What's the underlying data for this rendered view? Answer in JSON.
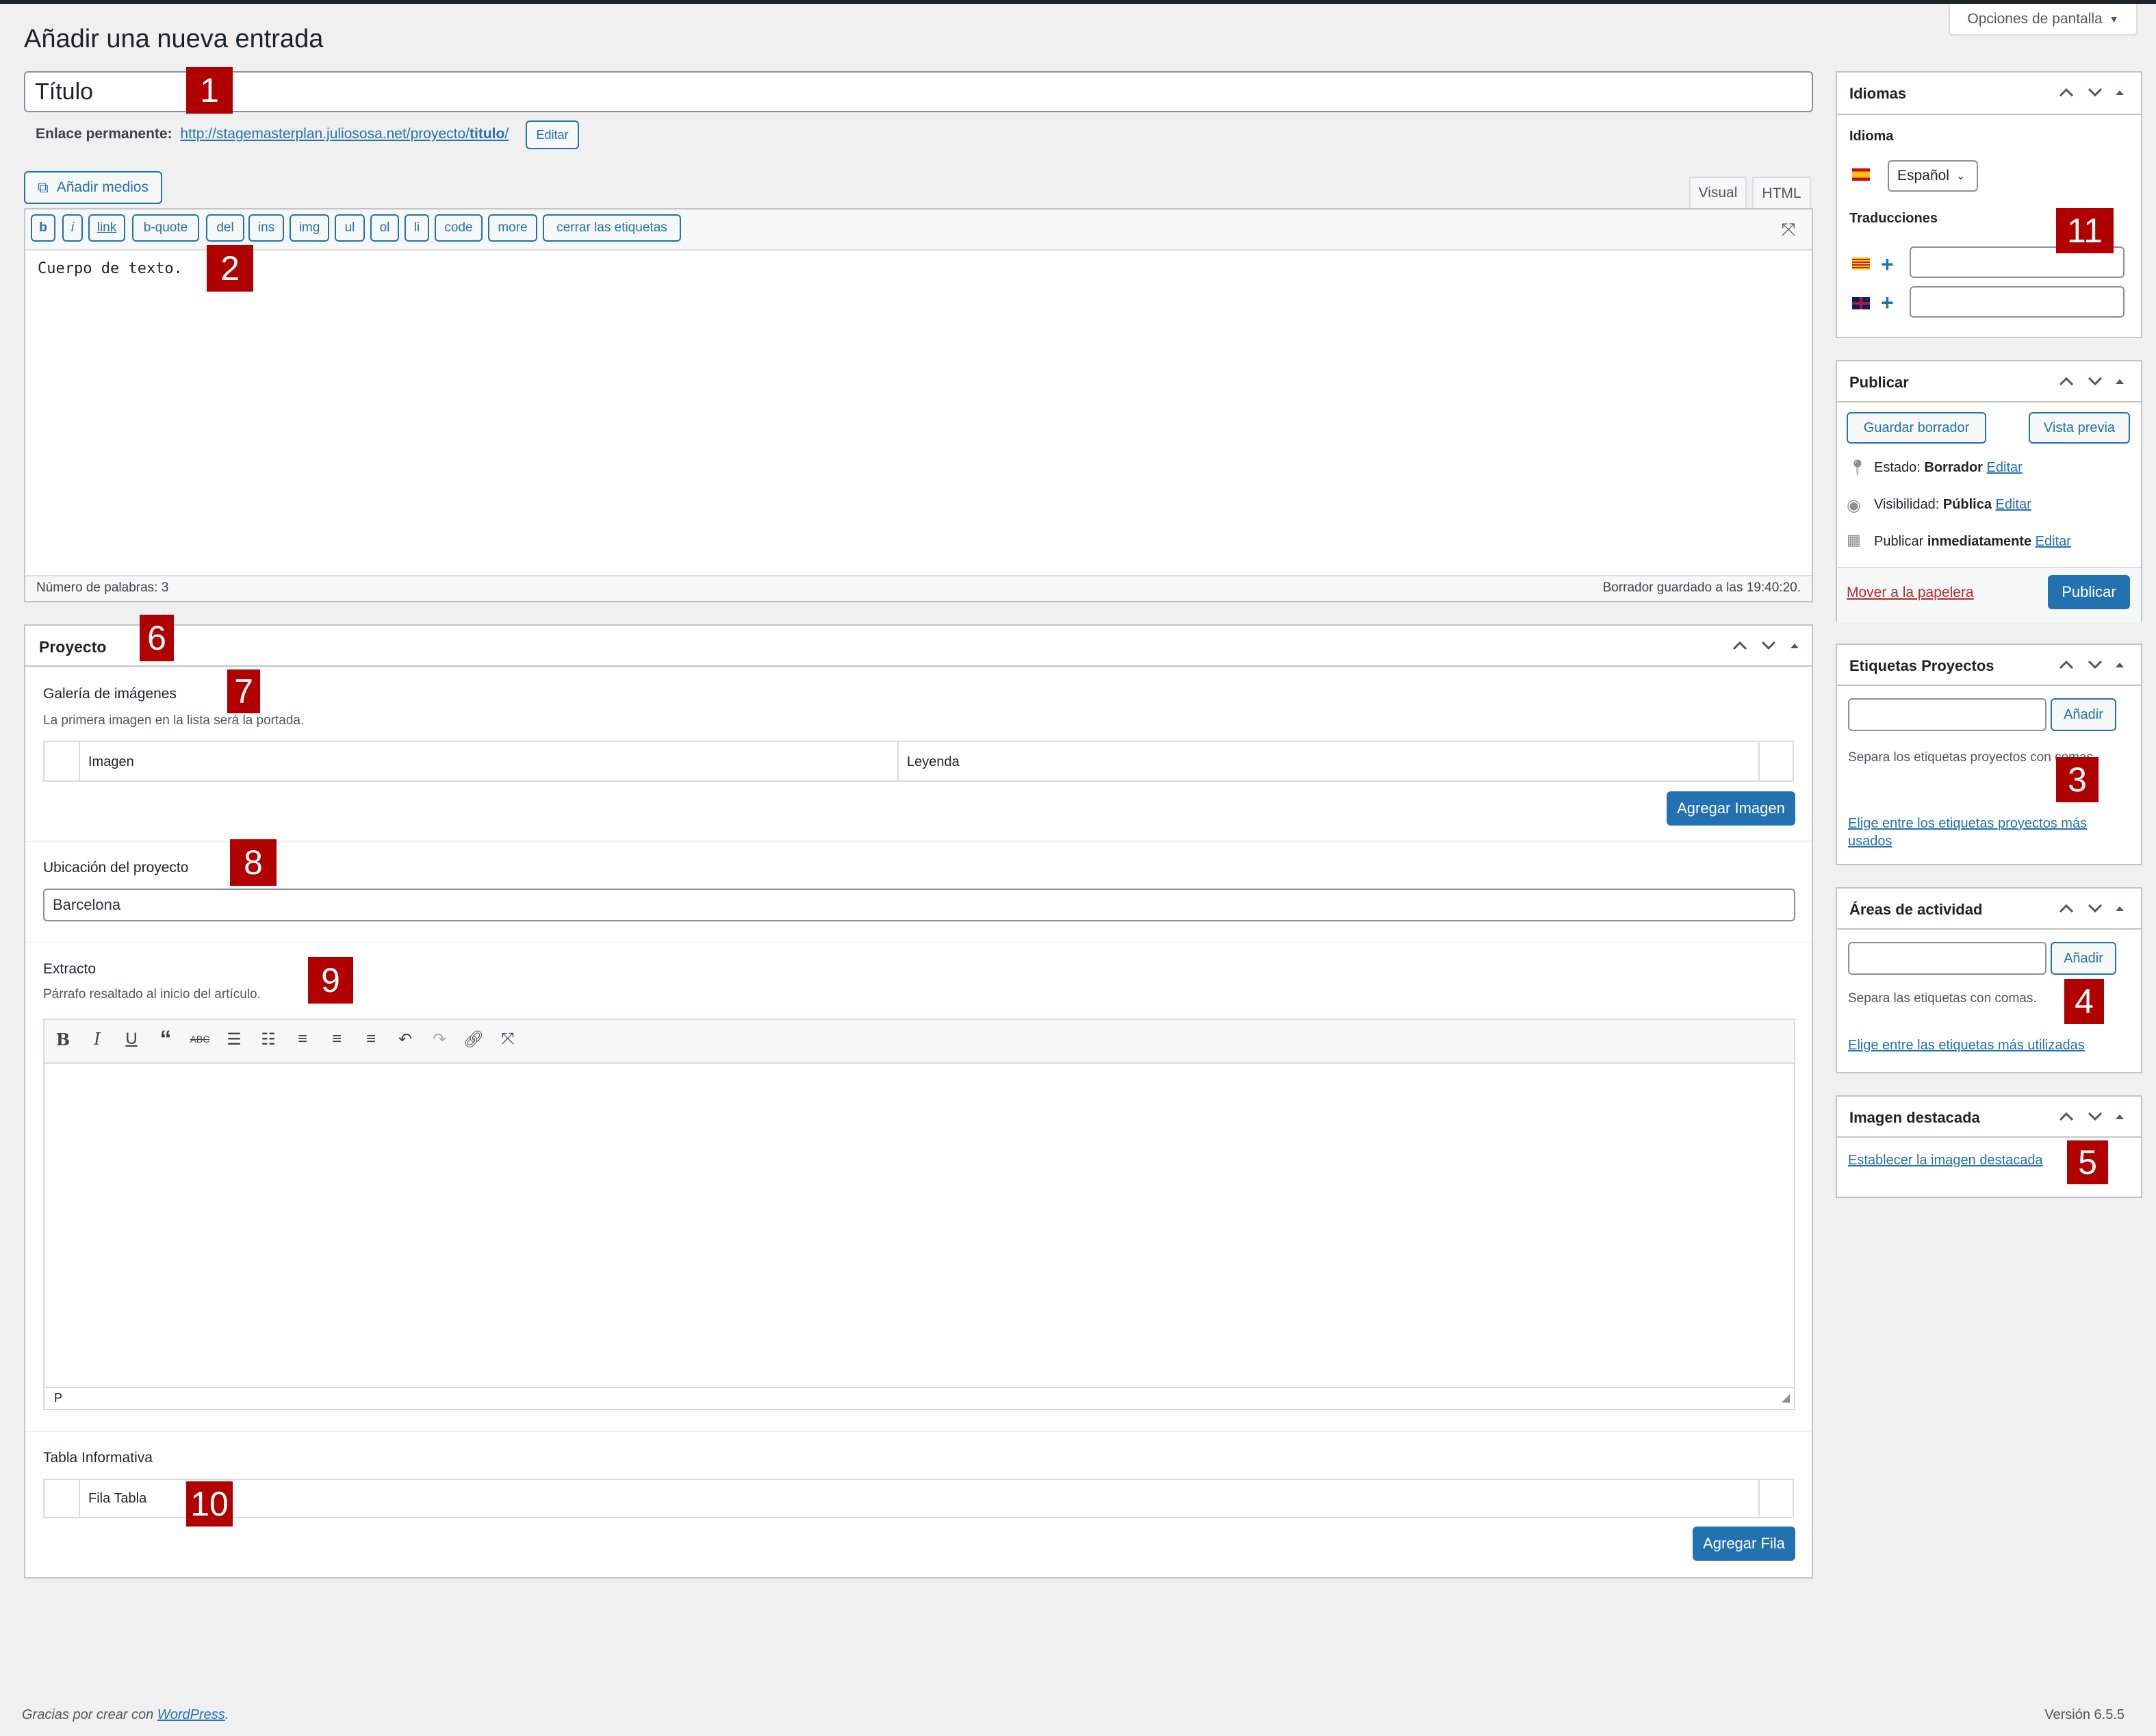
{
  "header": {
    "page_title": "Añadir una nueva entrada",
    "screen_options": "Opciones de pantalla"
  },
  "title_field": {
    "value": "Título"
  },
  "permalink": {
    "label": "Enlace permanente:",
    "url_base": "http://stagemasterplan.juliososa.net/proyecto/",
    "url_slug": "titulo",
    "url_end": "/",
    "edit_button": "Editar"
  },
  "editor": {
    "add_media": "Añadir medios",
    "tab_visual": "Visual",
    "tab_html": "HTML",
    "quicktags": [
      "b",
      "i",
      "link",
      "b-quote",
      "del",
      "ins",
      "img",
      "ul",
      "ol",
      "li",
      "code",
      "more",
      "cerrar las etiquetas"
    ],
    "content": "Cuerpo de texto.",
    "word_count": "Número de palabras: 3",
    "draft_saved": "Borrador guardado a las 19:40:20."
  },
  "proyecto": {
    "title": "Proyecto",
    "gallery": {
      "label": "Galería de imágenes",
      "description": "La primera imagen en la lista será la portada.",
      "columns": [
        "Imagen",
        "Leyenda"
      ],
      "add_button": "Agregar Imagen"
    },
    "location": {
      "label": "Ubicación del proyecto",
      "value": "Barcelona"
    },
    "excerpt": {
      "label": "Extracto",
      "description": "Párrafo resaltado al inicio del artículo.",
      "path": "P",
      "toolbar_icons": [
        "bold-icon",
        "italic-icon",
        "underline-icon",
        "blockquote-icon",
        "strikethrough-icon",
        "bullet-list-icon",
        "numbered-list-icon",
        "align-left-icon",
        "align-center-icon",
        "align-right-icon",
        "undo-icon",
        "redo-icon",
        "link-icon",
        "fullscreen-icon"
      ]
    },
    "info_table": {
      "label": "Tabla Informativa",
      "row_label": "Fila Tabla",
      "add_button": "Agregar Fila"
    }
  },
  "idiomas": {
    "title": "Idiomas",
    "language_label": "Idioma",
    "language_value": "Español",
    "translations_label": "Traducciones"
  },
  "publicar": {
    "title": "Publicar",
    "save_draft": "Guardar borrador",
    "preview": "Vista previa",
    "status_label": "Estado:",
    "status_value": "Borrador",
    "visibility_label": "Visibilidad:",
    "visibility_value": "Pública",
    "publish_label": "Publicar",
    "publish_value": "inmediatamente",
    "edit": "Editar",
    "trash": "Mover a la papelera",
    "publish_button": "Publicar"
  },
  "etiquetas_proyectos": {
    "title": "Etiquetas Proyectos",
    "add_button": "Añadir",
    "hint": "Separa los etiquetas proyectos con comas",
    "choose_link": "Elige entre los etiquetas proyectos más usados"
  },
  "areas": {
    "title": "Áreas de actividad",
    "add_button": "Añadir",
    "hint": "Separa las etiquetas con comas.",
    "choose_link": "Elige entre las etiquetas más utilizadas"
  },
  "imagen_destacada": {
    "title": "Imagen destacada",
    "set_link": "Establecer la imagen destacada"
  },
  "footer": {
    "thanks_prefix": "Gracias por crear con",
    "wordpress": "WordPress",
    "period": ".",
    "version": "Versión 6.5.5"
  },
  "markers": [
    "1",
    "2",
    "3",
    "4",
    "5",
    "6",
    "7",
    "8",
    "9",
    "10",
    "11"
  ],
  "colors": {
    "accent": "#2271b1",
    "marker": "#b00000",
    "danger": "#b32d2e"
  }
}
